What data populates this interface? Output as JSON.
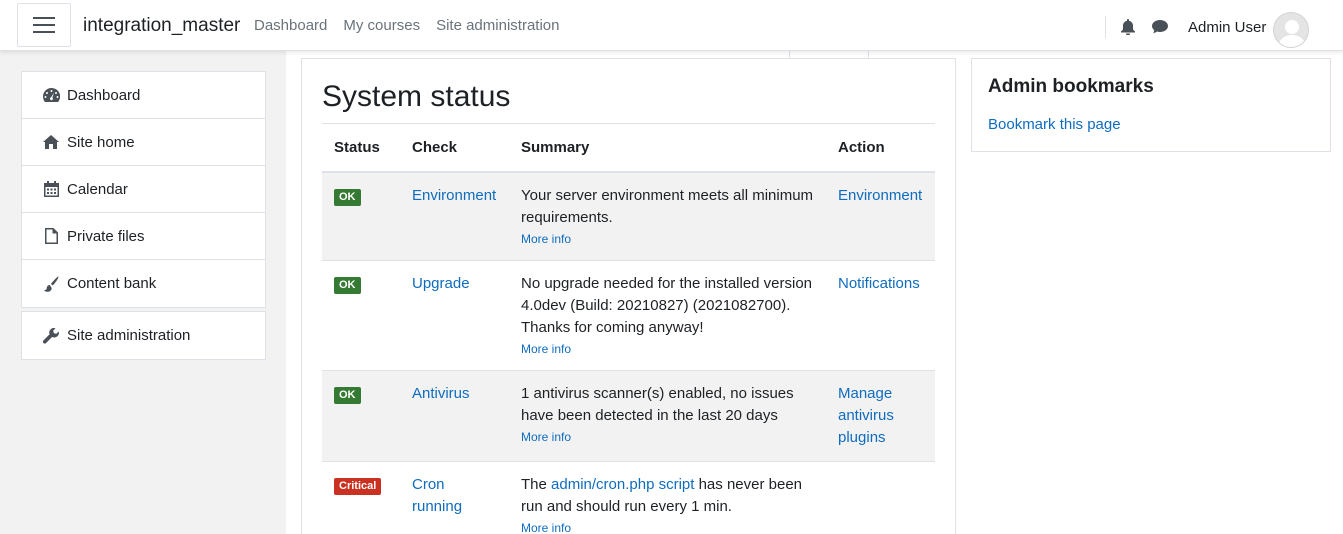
{
  "navbar": {
    "brand": "integration_master",
    "links": [
      "Dashboard",
      "My courses",
      "Site administration"
    ],
    "user_name": "Admin User"
  },
  "drawer": {
    "group1": [
      {
        "label": "Dashboard",
        "icon": "dashboard-icon"
      },
      {
        "label": "Site home",
        "icon": "home-icon"
      },
      {
        "label": "Calendar",
        "icon": "calendar-icon"
      },
      {
        "label": "Private files",
        "icon": "file-icon"
      },
      {
        "label": "Content bank",
        "icon": "paint-brush-icon"
      }
    ],
    "group2": [
      {
        "label": "Site administration",
        "icon": "wrench-icon"
      }
    ]
  },
  "main": {
    "title": "System status",
    "table": {
      "headers": [
        "Status",
        "Check",
        "Summary",
        "Action"
      ],
      "rows": [
        {
          "status": "OK",
          "check": "Environment",
          "summary": "Your server environment meets all minimum requirements.",
          "more": "More info",
          "action": "Environment"
        },
        {
          "status": "OK",
          "check": "Upgrade",
          "summary": "No upgrade needed for the installed version 4.0dev (Build: 20210827) (2021082700). Thanks for coming anyway!",
          "more": "More info",
          "action": "Notifications"
        },
        {
          "status": "OK",
          "check": "Antivirus",
          "summary": "1 antivirus scanner(s) enabled, no issues have been detected in the last 20 days",
          "more": "More info",
          "action": "Manage antivirus plugins"
        },
        {
          "status": "Critical",
          "check": "Cron running",
          "summary_prefix": "The ",
          "summary_link": "admin/cron.php script",
          "summary_suffix": " has never been run and should run every 1 min.",
          "more": "More info",
          "action": ""
        }
      ]
    }
  },
  "block": {
    "title": "Admin bookmarks",
    "link": "Bookmark this page"
  },
  "colors": {
    "link": "#0f6cbf",
    "ok": "#357a32",
    "critical": "#ca3120",
    "stripe": "#f2f2f2"
  }
}
